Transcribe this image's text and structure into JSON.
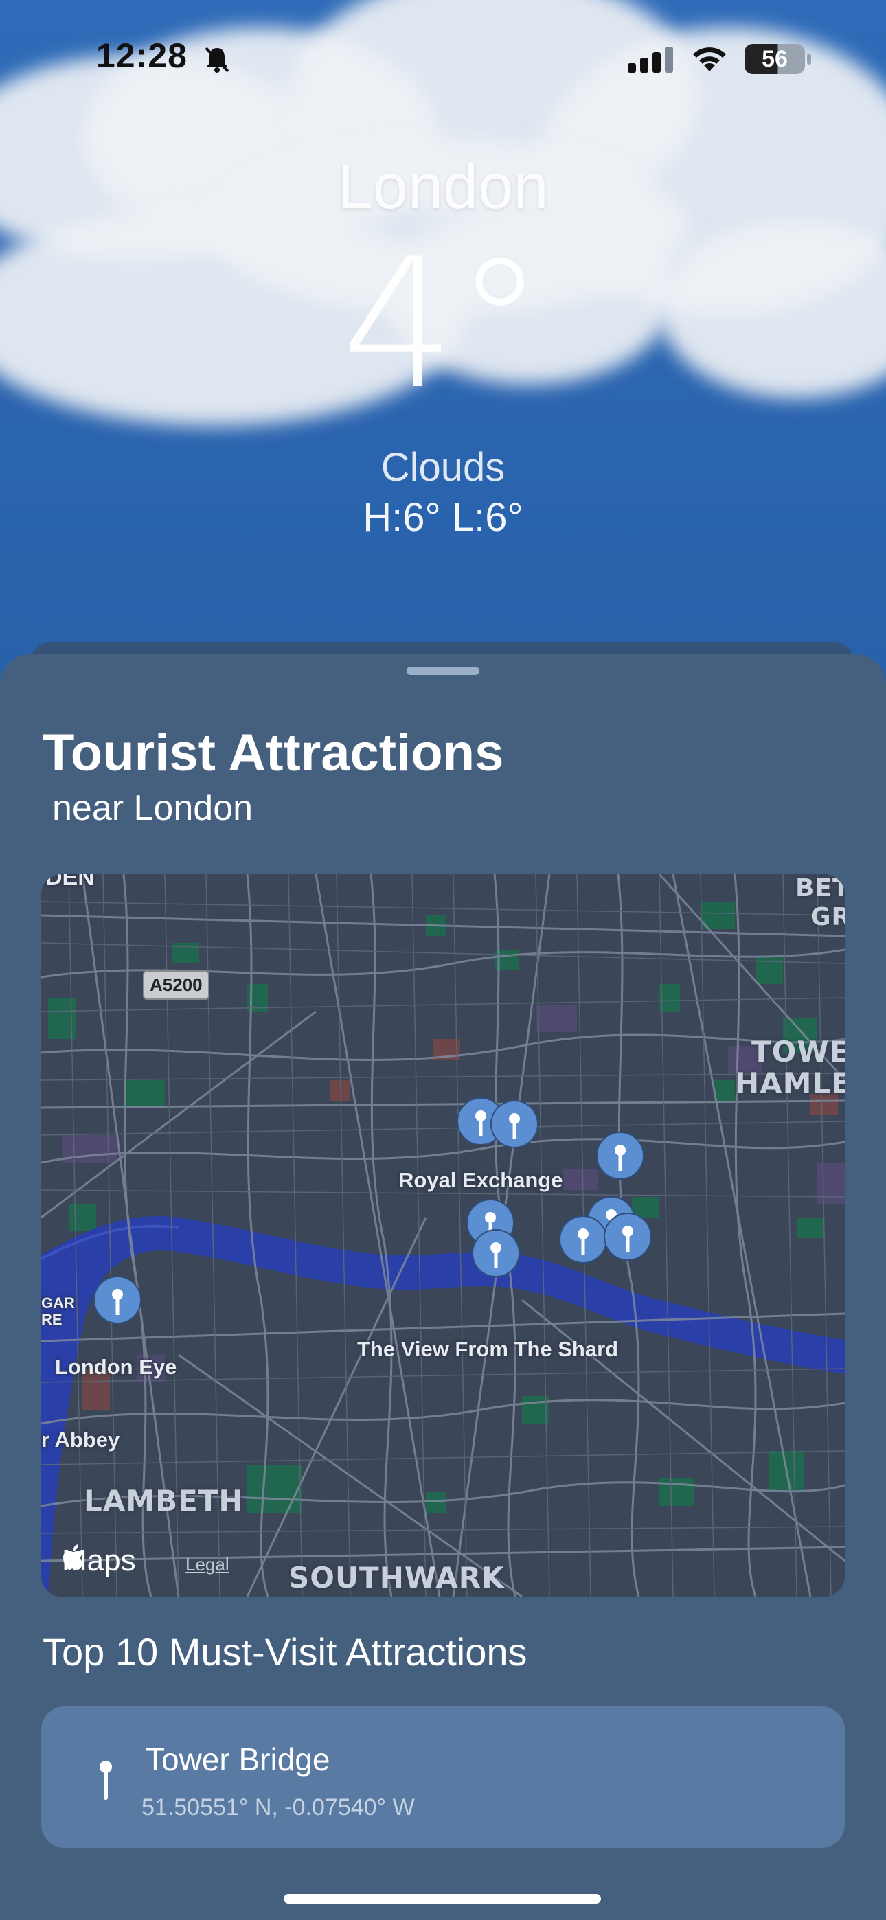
{
  "status_bar": {
    "time": "12:28",
    "battery": "56",
    "icons": [
      "bell-slash-icon",
      "cellular-signal-icon",
      "wifi-icon",
      "battery-icon"
    ]
  },
  "weather": {
    "city": "London",
    "temperature": "4°",
    "condition": "Clouds",
    "high_low": "H:6° L:6°"
  },
  "sheet": {
    "title": "Tourist Attractions",
    "subtitle": "near London"
  },
  "map": {
    "labels": {
      "royal_exchange": "Royal Exchange",
      "the_view_from_the_shard": "The View From The Shard",
      "london_eye": "London Eye",
      "abbey": "r Abbey",
      "lambeth": "LAMBETH",
      "southwark": "SOUTHWARK",
      "tower_hamlets_1": "TOWER",
      "tower_hamlets_2": "HAMLET",
      "beth_1": "BETI",
      "beth_2": "GR",
      "garden_1": "GAR",
      "garden_2": "RE",
      "top_left": "DEN",
      "road_shield": "A5200"
    },
    "attribution": "Maps",
    "legal": "Legal",
    "colors": {
      "water": "#2a3fa8",
      "land": "#3b4658",
      "parks": "#1f6a4f",
      "roads": "#8a95a8"
    }
  },
  "list": {
    "heading": "Top 10 Must-Visit Attractions",
    "items": [
      {
        "name": "Tower Bridge",
        "coords": "51.50551° N, -0.07540° W"
      }
    ]
  }
}
